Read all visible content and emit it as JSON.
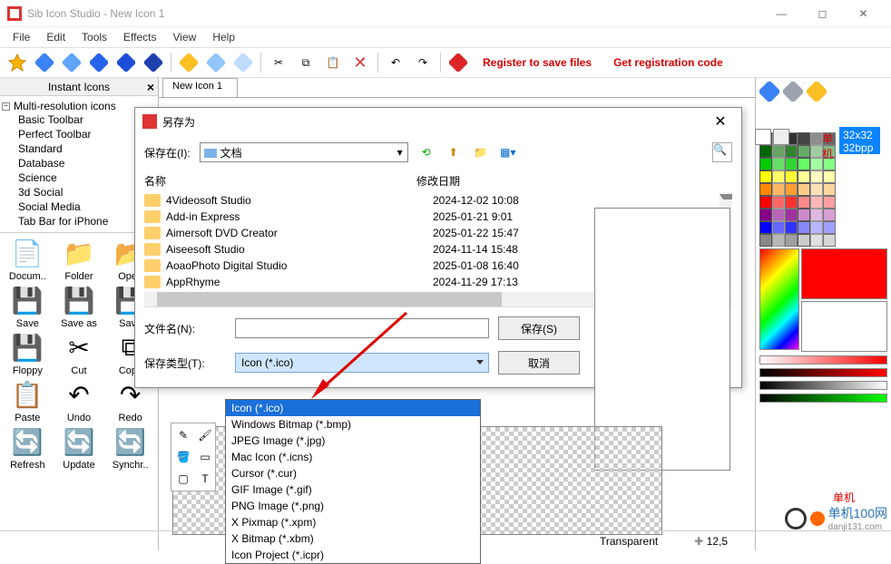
{
  "window": {
    "title": "Sib Icon Studio - New Icon 1"
  },
  "menu": [
    "File",
    "Edit",
    "Tools",
    "Effects",
    "View",
    "Help"
  ],
  "toolbar_links": {
    "register": "Register to save files",
    "getcode": "Get registration code"
  },
  "left": {
    "panel_title": "Instant Icons",
    "tree_root": "Multi-resolution icons",
    "tree_items": [
      "Basic Toolbar",
      "Perfect Toolbar",
      "Standard",
      "Database",
      "Science",
      "3d Social",
      "Social Media",
      "Tab Bar for iPhone"
    ],
    "grid": [
      "Docum..",
      "Folder",
      "Open",
      "Save",
      "Save as",
      "Save",
      "Floppy",
      "Cut",
      "Copy",
      "Paste",
      "Undo",
      "Redo",
      "Refresh",
      "Update",
      "Synchr.."
    ]
  },
  "tabs": [
    "New Icon 1"
  ],
  "right": {
    "size_chip_line1": "32x32",
    "size_chip_line2": "32bpp",
    "dup_label": "单机",
    "red_label": "单机"
  },
  "dialog": {
    "title": "另存为",
    "save_in_label": "保存在(I):",
    "save_in_value": "文档",
    "col_name": "名称",
    "col_date": "修改日期",
    "rows": [
      {
        "n": "4Videosoft Studio",
        "d": "2024-12-02 10:08"
      },
      {
        "n": "Add-in Express",
        "d": "2025-01-21 9:01"
      },
      {
        "n": "Aimersoft DVD Creator",
        "d": "2025-01-22 15:47"
      },
      {
        "n": "Aiseesoft Studio",
        "d": "2024-11-14 15:48"
      },
      {
        "n": "AoaoPhoto Digital Studio",
        "d": "2025-01-08 16:40"
      },
      {
        "n": "AppRhyme",
        "d": "2024-11-29 17:13"
      }
    ],
    "filename_label": "文件名(N):",
    "filetype_label": "保存类型(T):",
    "filetype_value": "Icon (*.ico)",
    "save_btn": "保存(S)",
    "cancel_btn": "取消",
    "type_options": [
      "Icon (*.ico)",
      "Windows Bitmap (*.bmp)",
      "JPEG Image (*.jpg)",
      "Mac Icon (*.icns)",
      "Cursor (*.cur)",
      "GIF Image (*.gif)",
      "PNG Image (*.png)",
      "X Pixmap (*.xpm)",
      "X Bitmap (*.xbm)",
      "Icon Project (*.icpr)"
    ]
  },
  "status": {
    "coord": "12,5",
    "transparent": "Transparent"
  },
  "watermark": {
    "line1": "单机100网",
    "line2": "danji131.com"
  }
}
